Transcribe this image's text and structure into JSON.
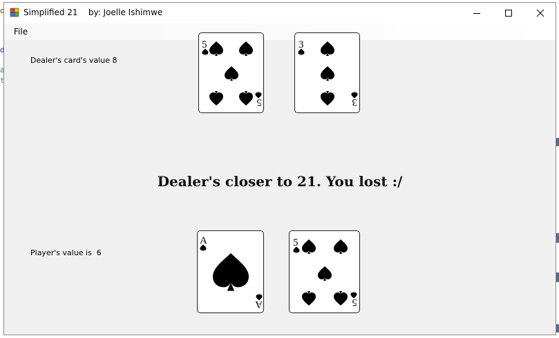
{
  "window": {
    "title": "Simplified 21    by: Joelle Ishimwe",
    "controls": {
      "minimize": "minimize",
      "maximize": "maximize",
      "close": "close"
    }
  },
  "menu": {
    "file_label": "File"
  },
  "dealer": {
    "value_label": "Dealer's card's value 8",
    "cards": [
      {
        "rank": "5",
        "suit": "spades"
      },
      {
        "rank": "3",
        "suit": "spades"
      }
    ]
  },
  "result_message": "Dealer's closer to 21. You lost :/",
  "player": {
    "value_label": "Player's value is  6",
    "cards": [
      {
        "rank": "A",
        "suit": "spades"
      },
      {
        "rank": "5",
        "suit": "spades"
      }
    ]
  },
  "background_app": {
    "left_chars": [
      "o",
      "d",
      "a",
      "t"
    ]
  },
  "colors": {
    "card_ink": "#000000",
    "window_bg": "#f0f0f0",
    "scroll_mark": "#5a6b8a"
  },
  "icons": [
    "app-icon",
    "minimize-icon",
    "maximize-icon",
    "close-icon",
    "spade-icon"
  ]
}
